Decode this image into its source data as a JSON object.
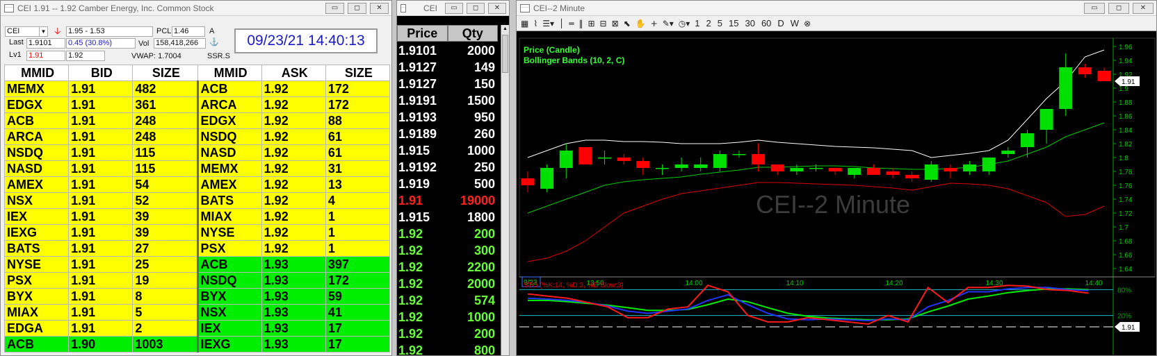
{
  "level2": {
    "window_title": "CEI     1.91 -- 1.92     Camber Energy, Inc. Common Stock",
    "symbol": "CEI",
    "range": "1.95 - 1.53",
    "pcl_label": "PCL",
    "pcl_value": "1.46",
    "a_label": "A",
    "last_label": "Last",
    "last_value": "1.9101",
    "change": "0.45  (30.8%)",
    "vol_label": "Vol",
    "vol_value": "158,418,266",
    "lv1_label": "Lv1",
    "lv1_bid": "1.91",
    "lv1_ask": "1.92",
    "vwap": "VWAP: 1.7004",
    "ssr": "SSR.S",
    "clock": "09/23/21 14:40:13",
    "headers": [
      "MMID",
      "BID",
      "SIZE",
      "MMID",
      "ASK",
      "SIZE"
    ],
    "bids": [
      [
        "MEMX",
        "1.91",
        "482"
      ],
      [
        "EDGX",
        "1.91",
        "361"
      ],
      [
        "ACB",
        "1.91",
        "248"
      ],
      [
        "ARCA",
        "1.91",
        "248"
      ],
      [
        "NSDQ",
        "1.91",
        "115"
      ],
      [
        "NASD",
        "1.91",
        "115"
      ],
      [
        "AMEX",
        "1.91",
        "54"
      ],
      [
        "NSX",
        "1.91",
        "52"
      ],
      [
        "IEX",
        "1.91",
        "39"
      ],
      [
        "IEXG",
        "1.91",
        "39"
      ],
      [
        "BATS",
        "1.91",
        "27"
      ],
      [
        "NYSE",
        "1.91",
        "25"
      ],
      [
        "PSX",
        "1.91",
        "19"
      ],
      [
        "BYX",
        "1.91",
        "8"
      ],
      [
        "MIAX",
        "1.91",
        "5"
      ],
      [
        "EDGA",
        "1.91",
        "2"
      ],
      [
        "ACB",
        "1.90",
        "1003"
      ]
    ],
    "asks": [
      [
        "ACB",
        "1.92",
        "172"
      ],
      [
        "ARCA",
        "1.92",
        "172"
      ],
      [
        "EDGX",
        "1.92",
        "88"
      ],
      [
        "NSDQ",
        "1.92",
        "61"
      ],
      [
        "NASD",
        "1.92",
        "61"
      ],
      [
        "MEMX",
        "1.92",
        "31"
      ],
      [
        "AMEX",
        "1.92",
        "13"
      ],
      [
        "BATS",
        "1.92",
        "4"
      ],
      [
        "MIAX",
        "1.92",
        "1"
      ],
      [
        "NYSE",
        "1.92",
        "1"
      ],
      [
        "PSX",
        "1.92",
        "1"
      ],
      [
        "ACB",
        "1.93",
        "397"
      ],
      [
        "NSDQ",
        "1.93",
        "172"
      ],
      [
        "BYX",
        "1.93",
        "59"
      ],
      [
        "NSX",
        "1.93",
        "41"
      ],
      [
        "IEX",
        "1.93",
        "17"
      ],
      [
        "IEXG",
        "1.93",
        "17"
      ]
    ],
    "colors": {
      "level_191": "#ffff00",
      "level_192": "#ffff00",
      "level_190": "#00ee00",
      "level_193": "#00ee00"
    }
  },
  "tns": {
    "window_title": "CEI",
    "headers": [
      "Price",
      "Qty"
    ],
    "rows": [
      [
        "1.9101",
        "2000",
        "#ffffff"
      ],
      [
        "1.9127",
        "149",
        "#ffffff"
      ],
      [
        "1.9127",
        "150",
        "#ffffff"
      ],
      [
        "1.9191",
        "1500",
        "#ffffff"
      ],
      [
        "1.9193",
        "950",
        "#ffffff"
      ],
      [
        "1.9189",
        "260",
        "#ffffff"
      ],
      [
        "1.915",
        "1000",
        "#ffffff"
      ],
      [
        "1.9192",
        "250",
        "#ffffff"
      ],
      [
        "1.919",
        "500",
        "#ffffff"
      ],
      [
        "1.91",
        "19000",
        "#ff2020"
      ],
      [
        "1.915",
        "1800",
        "#ffffff"
      ],
      [
        "1.92",
        "200",
        "#66ff33"
      ],
      [
        "1.92",
        "300",
        "#66ff33"
      ],
      [
        "1.92",
        "2200",
        "#66ff33"
      ],
      [
        "1.92",
        "2000",
        "#66ff33"
      ],
      [
        "1.92",
        "574",
        "#66ff33"
      ],
      [
        "1.92",
        "1000",
        "#66ff33"
      ],
      [
        "1.92",
        "200",
        "#66ff33"
      ],
      [
        "1.92",
        "800",
        "#66ff33"
      ]
    ]
  },
  "chart": {
    "window_title": "CEI--2 Minute",
    "watermark": "CEI--2 Minute",
    "legend_price": "Price (Candle)",
    "legend_bb": "Bollinger Bands (10, 2, C)",
    "last_price_tag": "1.91",
    "toolbar_periods": [
      "1",
      "2",
      "5",
      "15",
      "30",
      "60",
      "D",
      "W"
    ],
    "stoch_label": "STO (%K:14, %D:3, %D Slow:3)",
    "stoch_last_tag": "1.91",
    "colors": {
      "up": "#00e000",
      "down": "#ff0000",
      "bb_upper": "#ffffff",
      "bb_mid": "#00cc00",
      "bb_lower": "#dd0000",
      "axis": "#00cc00"
    }
  },
  "chart_data": {
    "type": "candlestick",
    "title": "CEI--2 Minute",
    "date": "9/23",
    "x_ticks": [
      "9/23",
      "13:50",
      "14:00",
      "14:10",
      "14:20",
      "14:30",
      "14:40"
    ],
    "y_ticks": [
      "1.64",
      "1.66",
      "1.68",
      "1.7",
      "1.72",
      "1.74",
      "1.76",
      "1.78",
      "1.8",
      "1.82",
      "1.84",
      "1.86",
      "1.88",
      "1.9",
      "1.92",
      "1.94",
      "1.96"
    ],
    "ylim": [
      1.63,
      1.97
    ],
    "candles": [
      {
        "o": 1.77,
        "h": 1.78,
        "l": 1.75,
        "c": 1.76
      },
      {
        "o": 1.755,
        "h": 1.79,
        "l": 1.75,
        "c": 1.785
      },
      {
        "o": 1.785,
        "h": 1.82,
        "l": 1.77,
        "c": 1.81
      },
      {
        "o": 1.815,
        "h": 1.815,
        "l": 1.79,
        "c": 1.79
      },
      {
        "o": 1.8,
        "h": 1.81,
        "l": 1.79,
        "c": 1.8
      },
      {
        "o": 1.8,
        "h": 1.805,
        "l": 1.79,
        "c": 1.795
      },
      {
        "o": 1.795,
        "h": 1.8,
        "l": 1.775,
        "c": 1.785
      },
      {
        "o": 1.785,
        "h": 1.79,
        "l": 1.775,
        "c": 1.785
      },
      {
        "o": 1.785,
        "h": 1.8,
        "l": 1.78,
        "c": 1.79
      },
      {
        "o": 1.785,
        "h": 1.8,
        "l": 1.78,
        "c": 1.79
      },
      {
        "o": 1.785,
        "h": 1.81,
        "l": 1.78,
        "c": 1.805
      },
      {
        "o": 1.805,
        "h": 1.81,
        "l": 1.8,
        "c": 1.805
      },
      {
        "o": 1.805,
        "h": 1.82,
        "l": 1.78,
        "c": 1.79
      },
      {
        "o": 1.79,
        "h": 1.79,
        "l": 1.775,
        "c": 1.78
      },
      {
        "o": 1.78,
        "h": 1.79,
        "l": 1.775,
        "c": 1.785
      },
      {
        "o": 1.785,
        "h": 1.79,
        "l": 1.78,
        "c": 1.785
      },
      {
        "o": 1.785,
        "h": 1.785,
        "l": 1.775,
        "c": 1.78
      },
      {
        "o": 1.775,
        "h": 1.785,
        "l": 1.77,
        "c": 1.785
      },
      {
        "o": 1.785,
        "h": 1.79,
        "l": 1.775,
        "c": 1.775
      },
      {
        "o": 1.78,
        "h": 1.785,
        "l": 1.77,
        "c": 1.775
      },
      {
        "o": 1.775,
        "h": 1.78,
        "l": 1.765,
        "c": 1.77
      },
      {
        "o": 1.768,
        "h": 1.795,
        "l": 1.765,
        "c": 1.79
      },
      {
        "o": 1.785,
        "h": 1.79,
        "l": 1.77,
        "c": 1.78
      },
      {
        "o": 1.78,
        "h": 1.795,
        "l": 1.775,
        "c": 1.79
      },
      {
        "o": 1.78,
        "h": 1.8,
        "l": 1.775,
        "c": 1.8
      },
      {
        "o": 1.805,
        "h": 1.815,
        "l": 1.8,
        "c": 1.81
      },
      {
        "o": 1.815,
        "h": 1.84,
        "l": 1.8,
        "c": 1.835
      },
      {
        "o": 1.84,
        "h": 1.87,
        "l": 1.82,
        "c": 1.87
      },
      {
        "o": 1.87,
        "h": 1.95,
        "l": 1.86,
        "c": 1.93
      },
      {
        "o": 1.93,
        "h": 1.935,
        "l": 1.915,
        "c": 1.92
      },
      {
        "o": 1.925,
        "h": 1.93,
        "l": 1.91,
        "c": 1.91
      }
    ],
    "bb_upper": [
      1.8,
      1.81,
      1.82,
      1.825,
      1.825,
      1.823,
      1.823,
      1.822,
      1.82,
      1.82,
      1.82,
      1.822,
      1.825,
      1.822,
      1.82,
      1.818,
      1.816,
      1.815,
      1.814,
      1.812,
      1.81,
      1.8,
      1.803,
      1.806,
      1.81,
      1.825,
      1.855,
      1.885,
      1.91,
      1.945,
      1.955
    ],
    "bb_mid": [
      1.72,
      1.73,
      1.74,
      1.75,
      1.76,
      1.765,
      1.768,
      1.77,
      1.772,
      1.776,
      1.779,
      1.782,
      1.786,
      1.786,
      1.787,
      1.788,
      1.788,
      1.787,
      1.785,
      1.784,
      1.783,
      1.783,
      1.784,
      1.786,
      1.79,
      1.795,
      1.805,
      1.815,
      1.83,
      1.84,
      1.85
    ],
    "bb_lower": [
      1.65,
      1.655,
      1.665,
      1.68,
      1.7,
      1.72,
      1.73,
      1.74,
      1.748,
      1.752,
      1.756,
      1.76,
      1.764,
      1.764,
      1.763,
      1.762,
      1.761,
      1.76,
      1.758,
      1.756,
      1.753,
      1.758,
      1.763,
      1.762,
      1.76,
      1.755,
      1.745,
      1.735,
      1.715,
      1.718,
      1.73
    ],
    "stoch": {
      "ylim": [
        0,
        100
      ],
      "levels": [
        80,
        20
      ],
      "k": [
        70,
        65,
        60,
        50,
        40,
        15,
        15,
        35,
        40,
        90,
        75,
        20,
        5,
        5,
        15,
        10,
        5,
        0,
        20,
        5,
        85,
        50,
        85,
        85,
        90,
        88,
        80,
        78,
        72
      ],
      "d": [
        60,
        58,
        55,
        50,
        42,
        30,
        25,
        30,
        35,
        55,
        68,
        45,
        25,
        12,
        10,
        12,
        10,
        8,
        12,
        10,
        40,
        55,
        75,
        75,
        82,
        85,
        85,
        80,
        78
      ],
      "slow": [
        55,
        55,
        52,
        48,
        44,
        38,
        32,
        32,
        34,
        45,
        58,
        52,
        38,
        25,
        18,
        14,
        12,
        10,
        10,
        12,
        28,
        42,
        58,
        65,
        73,
        78,
        82,
        82,
        80
      ]
    }
  }
}
